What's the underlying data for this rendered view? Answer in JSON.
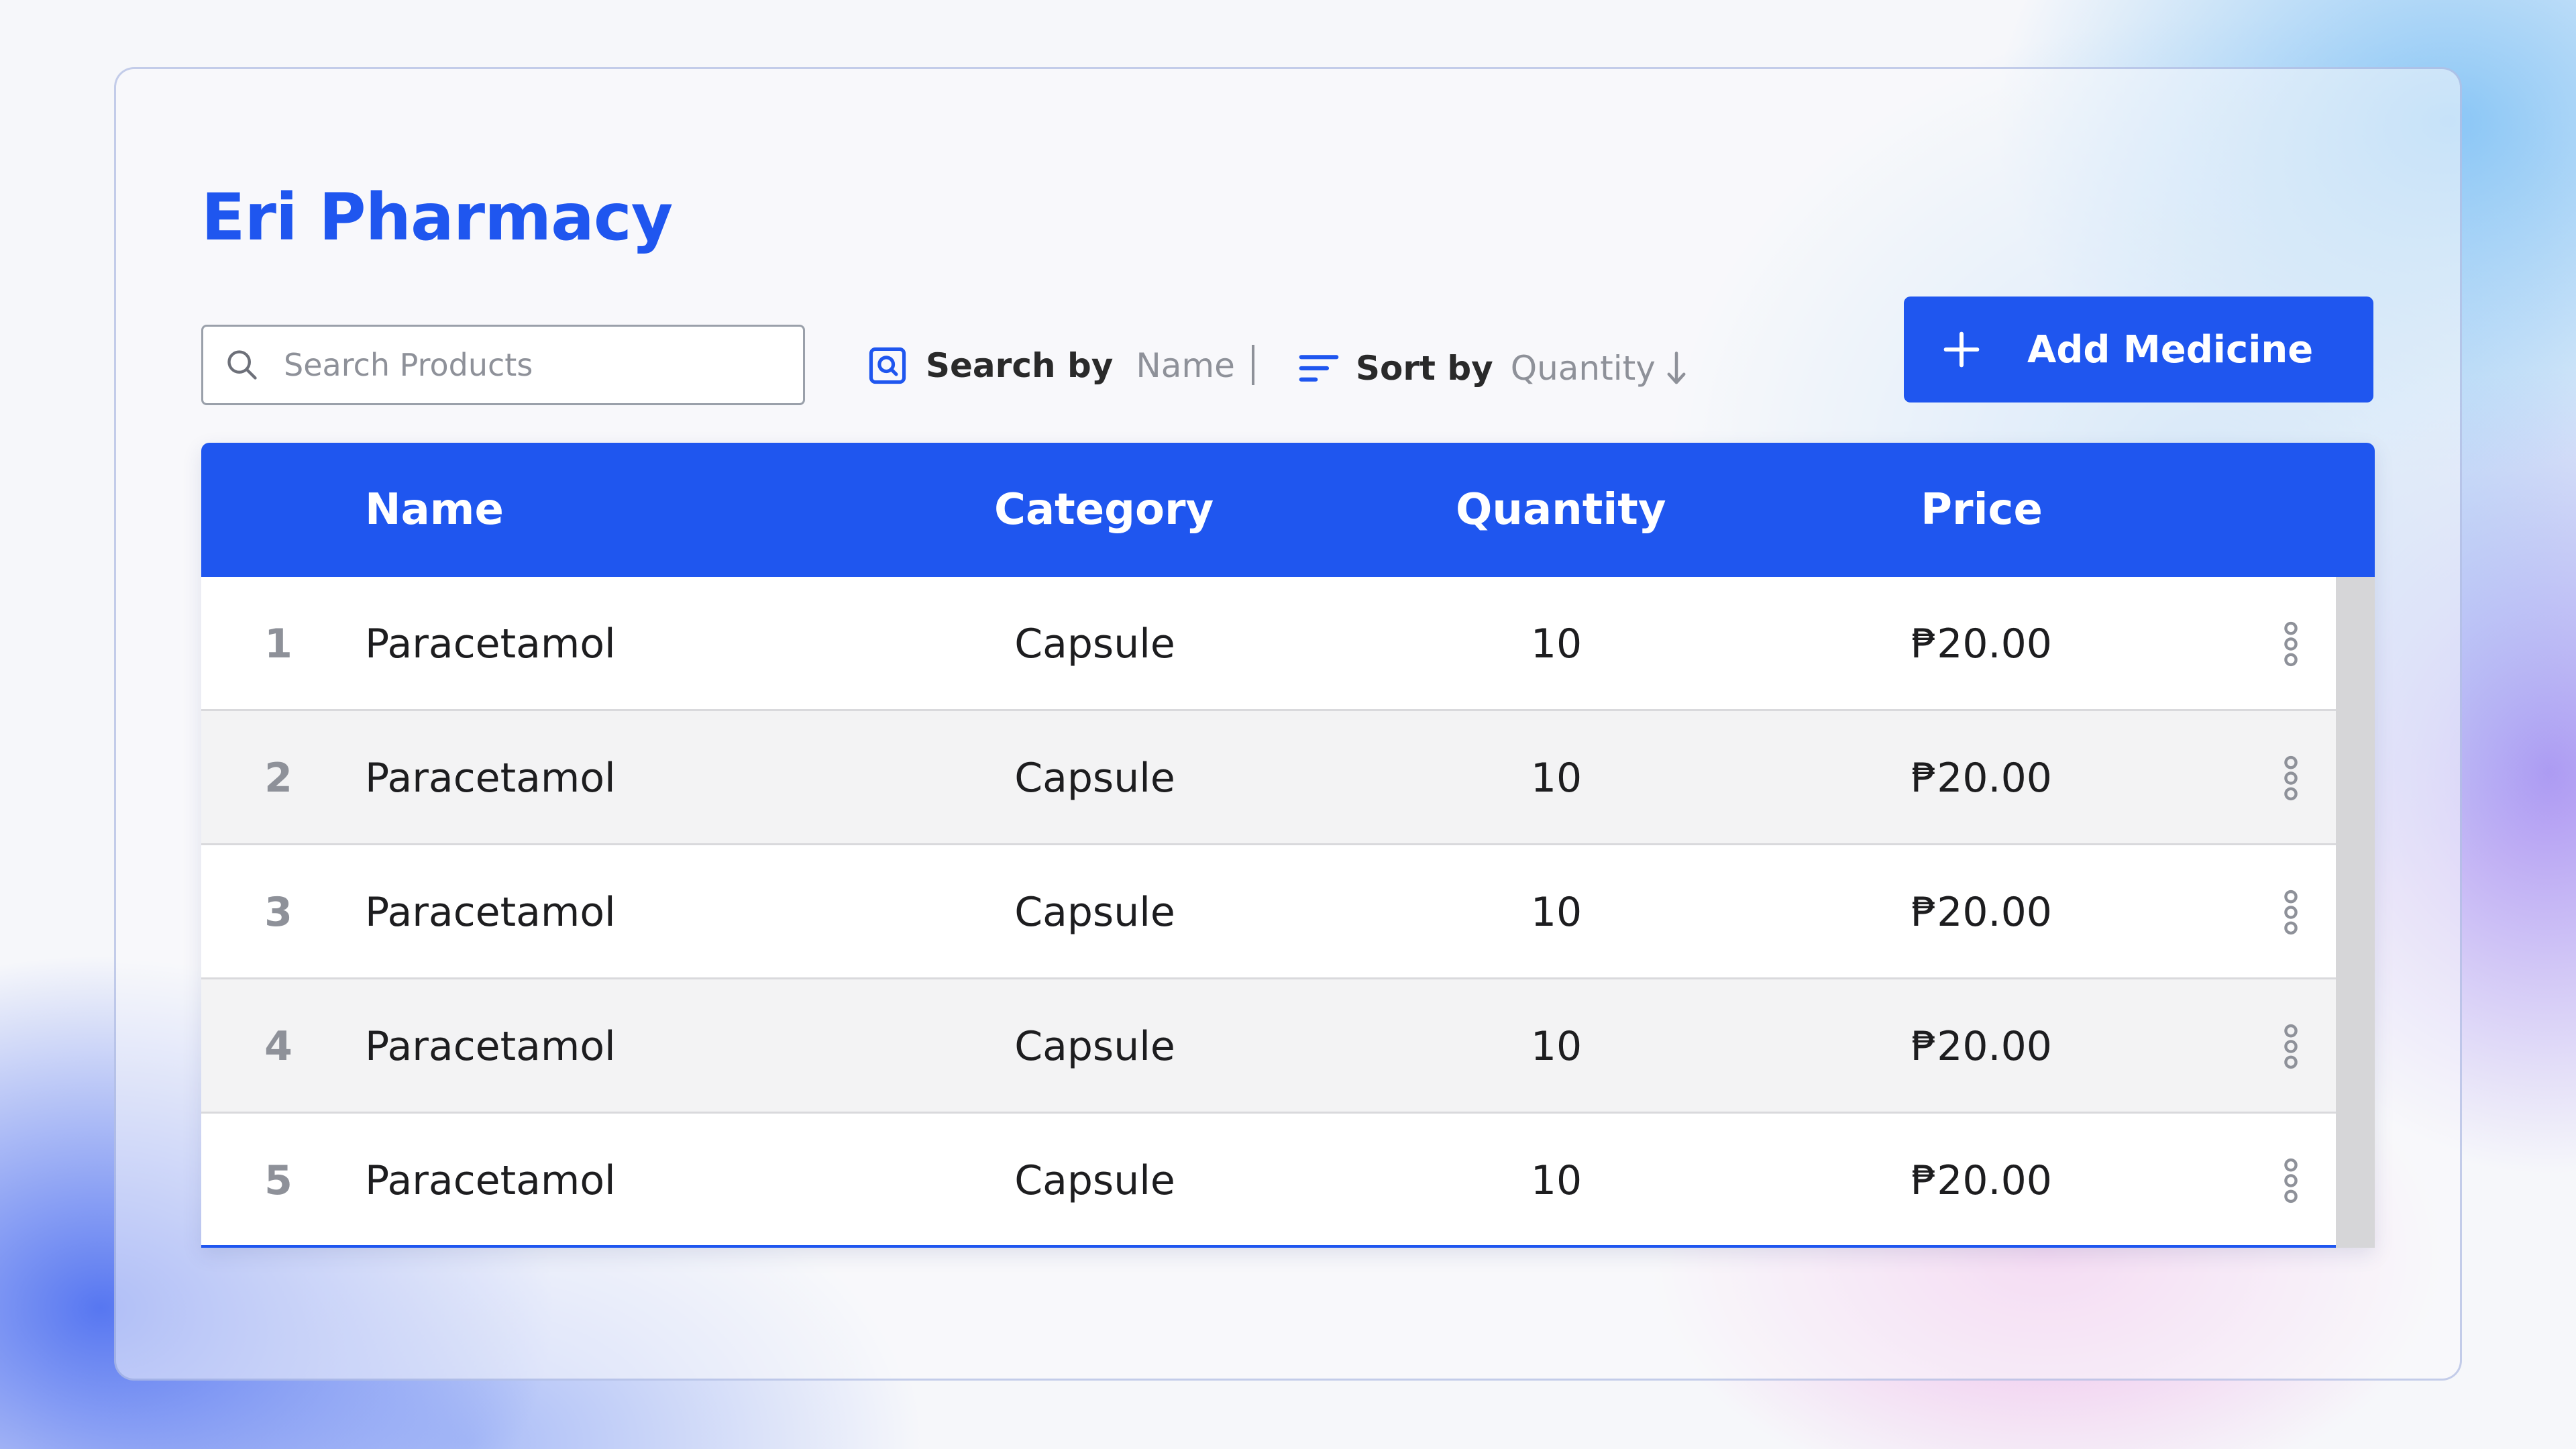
{
  "app": {
    "title": "Eri Pharmacy"
  },
  "search": {
    "placeholder": "Search Products",
    "icon": "search-icon"
  },
  "search_by": {
    "label": "Search by",
    "value": "Name",
    "icon": "search-square-icon"
  },
  "sort_by": {
    "label": "Sort by",
    "value": "Quantity",
    "icon": "sort-lines-icon",
    "direction_icon": "arrow-down-icon"
  },
  "add_button": {
    "label": "Add Medicine",
    "icon": "plus-icon"
  },
  "colors": {
    "accent": "#1f56ef",
    "muted": "#8e9199"
  },
  "table": {
    "columns": [
      "Name",
      "Category",
      "Quantity",
      "Price"
    ],
    "rows": [
      {
        "index": "1",
        "name": "Paracetamol",
        "category": "Capsule",
        "quantity": "10",
        "price": "₱20.00"
      },
      {
        "index": "2",
        "name": "Paracetamol",
        "category": "Capsule",
        "quantity": "10",
        "price": "₱20.00"
      },
      {
        "index": "3",
        "name": "Paracetamol",
        "category": "Capsule",
        "quantity": "10",
        "price": "₱20.00"
      },
      {
        "index": "4",
        "name": "Paracetamol",
        "category": "Capsule",
        "quantity": "10",
        "price": "₱20.00"
      },
      {
        "index": "5",
        "name": "Paracetamol",
        "category": "Capsule",
        "quantity": "10",
        "price": "₱20.00"
      }
    ]
  }
}
